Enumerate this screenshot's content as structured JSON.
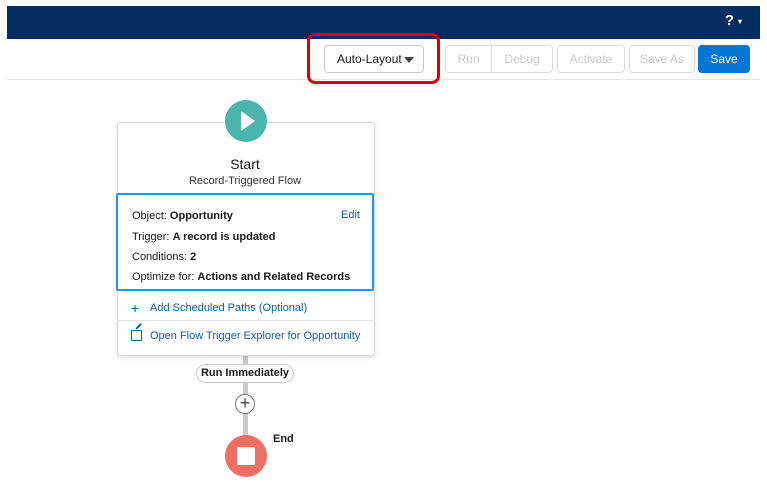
{
  "header": {
    "help_label": "?",
    "help_caret": "▾"
  },
  "toolbar": {
    "layout_select": "Auto-Layout",
    "run": "Run",
    "debug": "Debug",
    "activate": "Activate",
    "save_as": "Save As",
    "save": "Save"
  },
  "start_node": {
    "title": "Start",
    "subtitle": "Record-Triggered Flow",
    "edit": "Edit",
    "object_label": "Object:",
    "object_value": "Opportunity",
    "trigger_label": "Trigger:",
    "trigger_value": "A record is updated",
    "conditions_label": "Conditions:",
    "conditions_value": "2",
    "optimize_label": "Optimize for:",
    "optimize_value": "Actions and Related Records",
    "add_paths": "Add Scheduled Paths (Optional)",
    "open_explorer": "Open Flow Trigger Explorer for Opportunity"
  },
  "path": {
    "run_immediately": "Run Immediately",
    "add_symbol": "+"
  },
  "end_node": {
    "label": "End"
  },
  "colors": {
    "header": "#032d60",
    "brand": "#0176d3",
    "start": "#4bb5ad",
    "end": "#ef6e64",
    "highlight": "#e00000"
  }
}
